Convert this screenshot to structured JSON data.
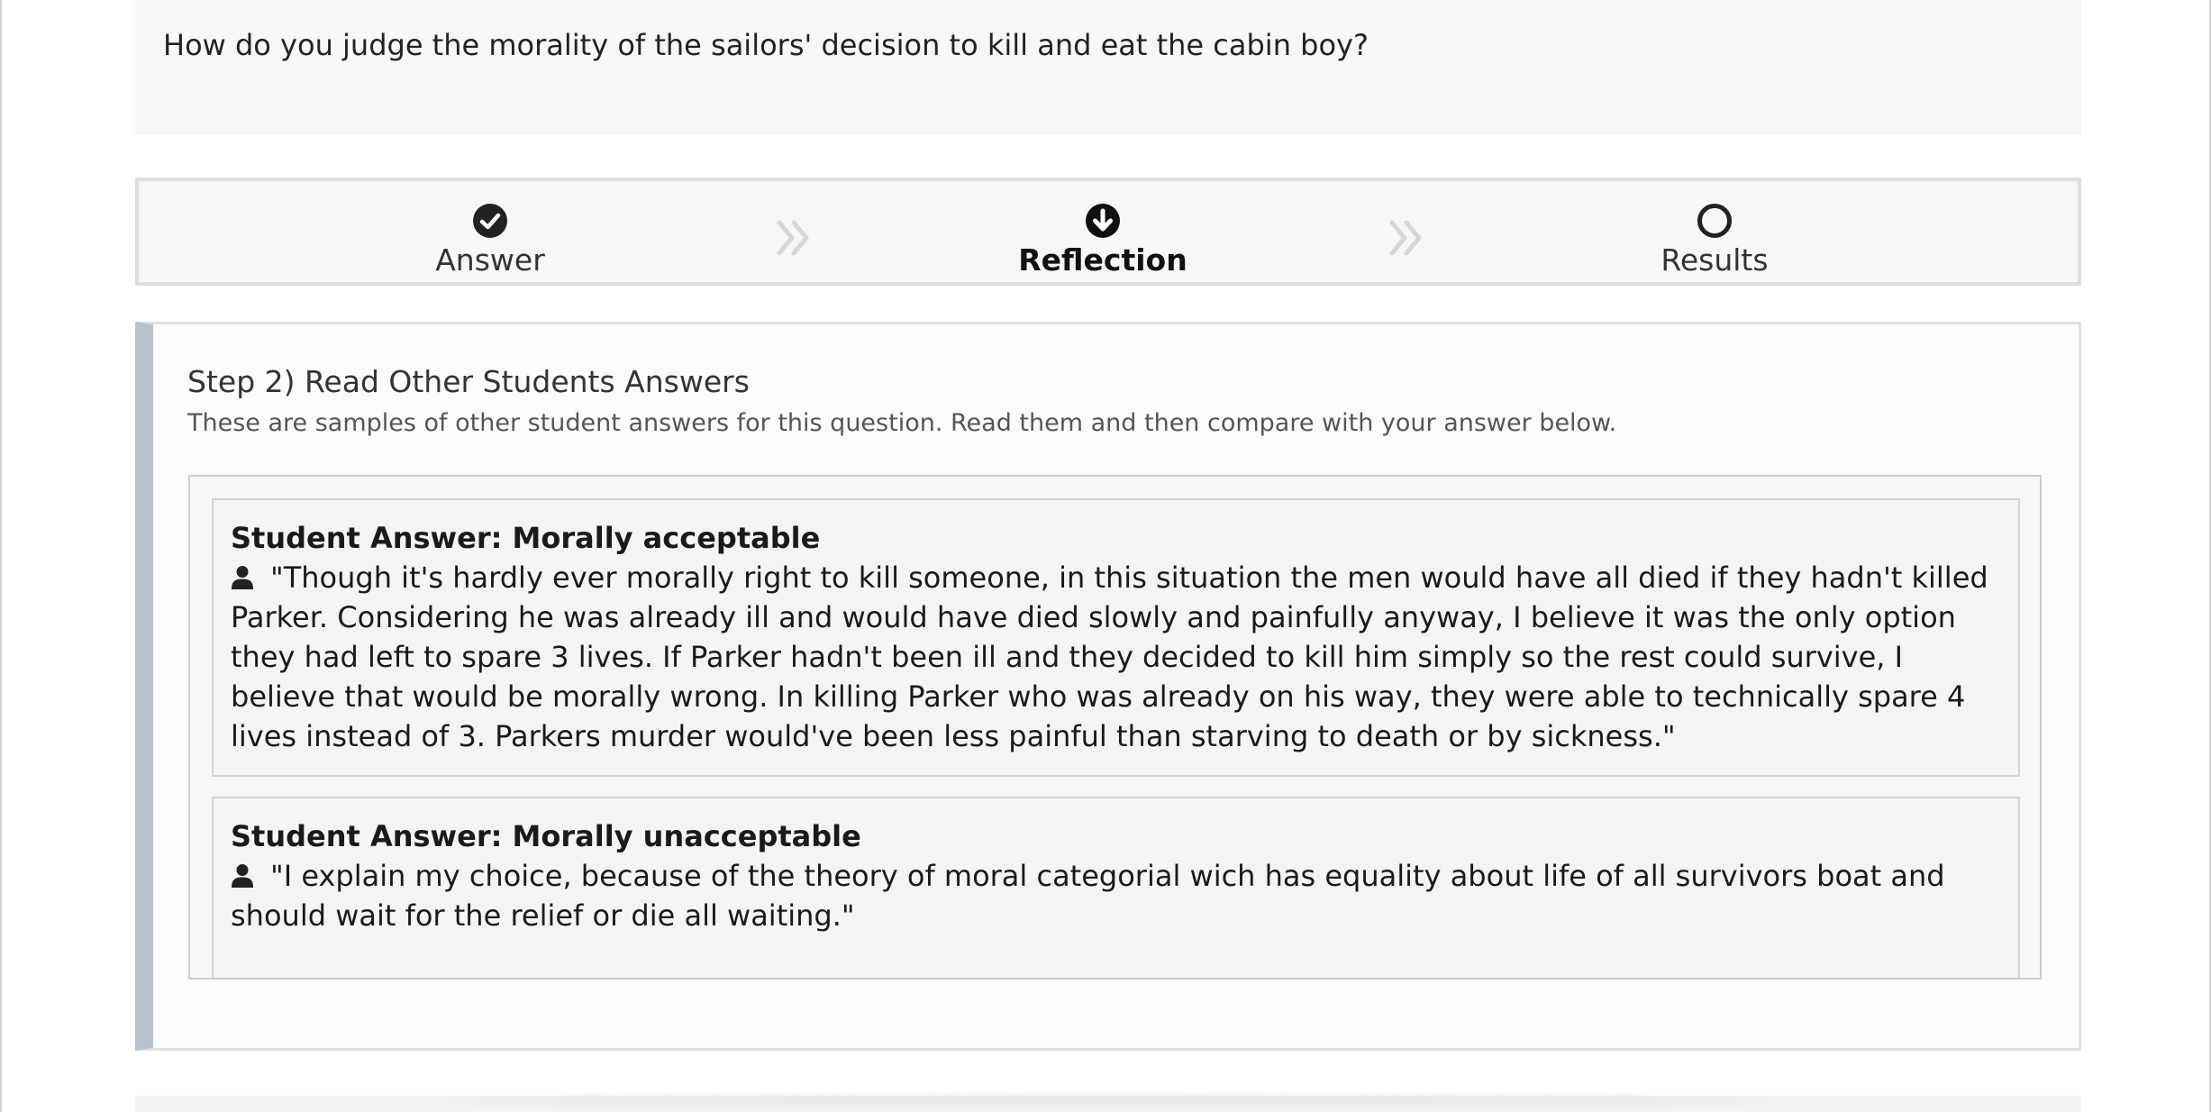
{
  "question": {
    "text": "How do you judge the morality of the sailors' decision to kill and eat the cabin boy?"
  },
  "steps": [
    {
      "label": "Answer",
      "icon": "check-circle-icon",
      "state": "done"
    },
    {
      "label": "Reflection",
      "icon": "arrow-down-circle-icon",
      "state": "current"
    },
    {
      "label": "Results",
      "icon": "empty-circle-icon",
      "state": "pending"
    }
  ],
  "panel": {
    "title": "Step 2) Read Other Students Answers",
    "subtitle": "These are samples of other student answers for this question. Read them and then compare with your answer below."
  },
  "answers": [
    {
      "heading": "Student Answer: Morally acceptable",
      "icon": "user-icon",
      "text": "\"Though it's hardly ever morally right to kill someone, in this situation the men would have all died if they hadn't killed Parker. Considering he was already ill and would have died slowly and painfully anyway, I believe it was the only option they had left to spare 3 lives. If Parker hadn't been ill and they decided to kill him simply so the rest could survive, I believe that would be morally wrong. In killing Parker who was already on his way, they were able to technically spare 4 lives instead of 3. Parkers murder would've been less painful than starving to death or by sickness.\""
    },
    {
      "heading": "Student Answer: Morally unacceptable",
      "icon": "user-icon",
      "text": "\"I explain my choice, because of the theory of moral categorial wich has equality about life of all survivors boat and should wait for the relief or die all waiting.\""
    }
  ],
  "colors": {
    "panel_accent": "#b9c1cc",
    "step_icon": "#222222",
    "step_arrow": "#d6d6d6"
  }
}
